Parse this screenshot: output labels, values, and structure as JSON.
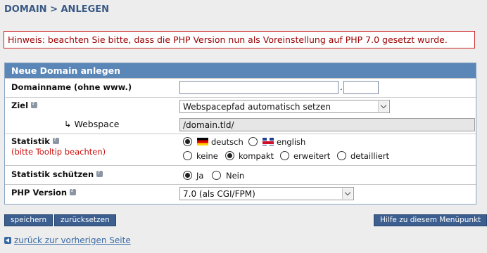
{
  "page": {
    "title": "DOMAIN > ANLEGEN",
    "notice": "Hinweis: beachten Sie bitte, dass die PHP Version nun als Voreinstellung auf PHP 7.0 gesetzt wurde."
  },
  "form": {
    "header": "Neue Domain anlegen",
    "domainname": {
      "label": "Domainname (ohne www.)",
      "value": "",
      "tld_value": "",
      "separator": "."
    },
    "ziel": {
      "label": "Ziel",
      "selected": "Webspacepfad automatisch setzen"
    },
    "webspace": {
      "arrow": "↳",
      "label": "Webspace",
      "value": "/domain.tld/"
    },
    "statistik": {
      "label": "Statistik",
      "hint": "(bitte Tooltip beachten)",
      "languages": [
        {
          "label": "deutsch",
          "selected": true,
          "flag": "de-flag"
        },
        {
          "label": "english",
          "selected": false,
          "flag": "uk-flag"
        }
      ],
      "modes": [
        {
          "label": "keine",
          "selected": false
        },
        {
          "label": "kompakt",
          "selected": true
        },
        {
          "label": "erweitert",
          "selected": false
        },
        {
          "label": "detailliert",
          "selected": false
        }
      ]
    },
    "statistik_schuetzen": {
      "label": "Statistik schützen",
      "options": [
        {
          "label": "Ja",
          "selected": true
        },
        {
          "label": "Nein",
          "selected": false
        }
      ]
    },
    "php_version": {
      "label": "PHP Version",
      "selected": "7.0 (als CGI/FPM)"
    }
  },
  "buttons": {
    "save": "speichern",
    "reset": "zurücksetzen",
    "help": "Hilfe zu diesem Menüpunkt"
  },
  "back_link": "zurück zur vorherigen Seite",
  "colors": {
    "title": "#3a5a85",
    "header_bg": "#5b86b8",
    "button_bg": "#3d5f8f",
    "notice_border": "#cc2222",
    "notice_text": "#9a0000",
    "hint_red": "#cc1111"
  }
}
